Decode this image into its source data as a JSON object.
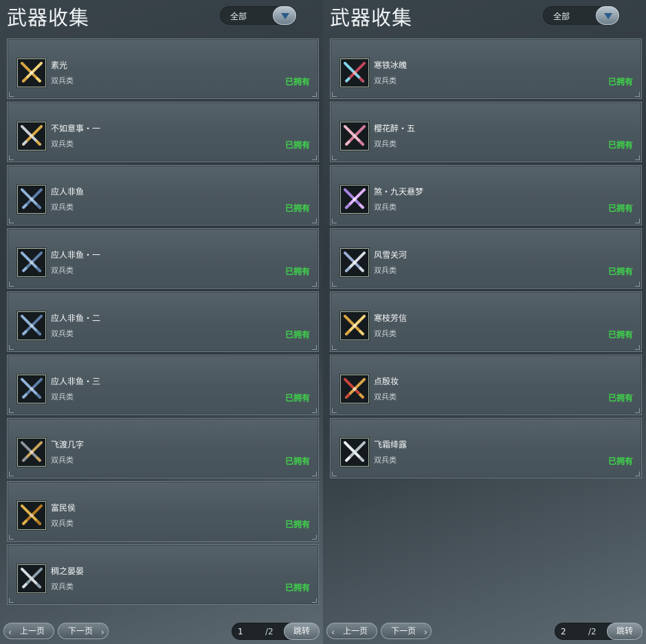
{
  "colors": {
    "owned": "#3ed34a",
    "panel_bg": "#333d44",
    "card_bg": "#4b575e"
  },
  "panels": [
    {
      "title": "武器收集",
      "filter": {
        "selected": "全部",
        "icon": "chevron-down-icon"
      },
      "items": [
        {
          "name": "素光",
          "type": "双兵类",
          "status": "已拥有",
          "icon": "gold-crossed-blades-icon"
        },
        {
          "name": "不如意事・一",
          "type": "双兵类",
          "status": "已拥有",
          "icon": "silver-gold-crossed-blades-icon"
        },
        {
          "name": "应人非鱼",
          "type": "双兵类",
          "status": "已拥有",
          "icon": "blue-crossed-blades-icon"
        },
        {
          "name": "应人非鱼・一",
          "type": "双兵类",
          "status": "已拥有",
          "icon": "blue-crossed-blades-icon"
        },
        {
          "name": "应人非鱼・二",
          "type": "双兵类",
          "status": "已拥有",
          "icon": "blue-crossed-blades-icon"
        },
        {
          "name": "应人非鱼・三",
          "type": "双兵类",
          "status": "已拥有",
          "icon": "blue-crossed-blades-icon"
        },
        {
          "name": "飞渡几字",
          "type": "双兵类",
          "status": "已拥有",
          "icon": "dark-crossed-blades-icon"
        },
        {
          "name": "富民侯",
          "type": "双兵类",
          "status": "已拥有",
          "icon": "gold-blade-icon"
        },
        {
          "name": "稠之晏晏",
          "type": "双兵类",
          "status": "已拥有",
          "icon": "silver-crossed-blades-icon"
        }
      ],
      "pager": {
        "prev": "上一页",
        "next": "下一页",
        "current": "1",
        "total": "/2",
        "jump": "跳转"
      }
    },
    {
      "title": "武器收集",
      "filter": {
        "selected": "全部",
        "icon": "chevron-down-icon"
      },
      "items": [
        {
          "name": "寒铁冰魄",
          "type": "双兵类",
          "status": "已拥有",
          "icon": "ice-crossed-blades-icon"
        },
        {
          "name": "樱花醉・五",
          "type": "双兵类",
          "status": "已拥有",
          "icon": "cherry-blossom-blades-icon"
        },
        {
          "name": "煞・九天悬梦",
          "type": "双兵类",
          "status": "已拥有",
          "icon": "purple-crossed-blades-icon"
        },
        {
          "name": "风雪关河",
          "type": "双兵类",
          "status": "已拥有",
          "icon": "steel-crossed-blades-icon"
        },
        {
          "name": "寒枝芳信",
          "type": "双兵类",
          "status": "已拥有",
          "icon": "gold-crossed-blades-icon"
        },
        {
          "name": "点殷妆",
          "type": "双兵类",
          "status": "已拥有",
          "icon": "red-crossed-blades-icon"
        },
        {
          "name": "飞霜绛露",
          "type": "双兵类",
          "status": "已拥有",
          "icon": "white-crossed-blades-icon"
        }
      ],
      "pager": {
        "prev": "上一页",
        "next": "下一页",
        "current": "2",
        "total": "/2",
        "jump": "跳转"
      }
    }
  ]
}
